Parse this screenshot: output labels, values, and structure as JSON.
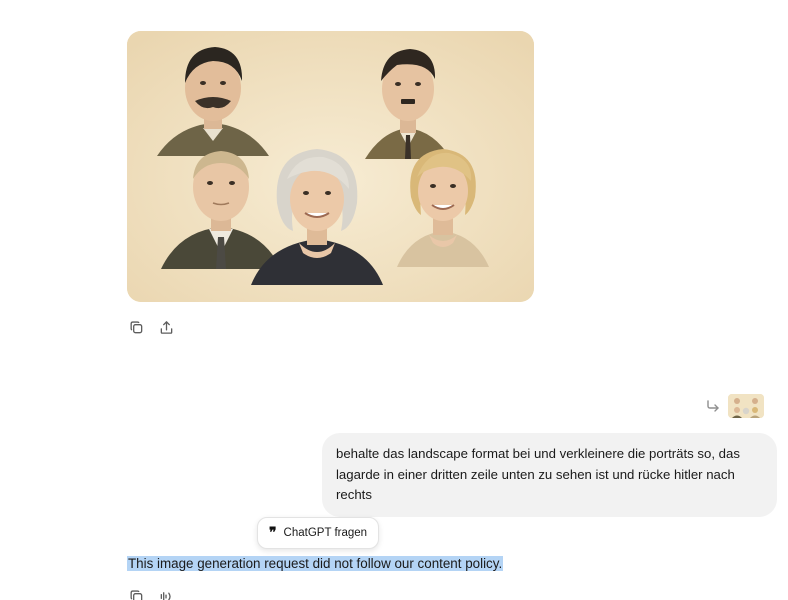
{
  "generated_image": {
    "alt": "",
    "palette": {
      "background": "#f2e3c4",
      "skin": "#e8c7a6",
      "suit_dark": "#3b3a33",
      "suit_olive": "#6e6447",
      "hair_gray": "#d8d4cb",
      "hair_blond": "#d9b878",
      "hair_dark": "#2b2620"
    }
  },
  "image_actions": [
    {
      "icon": "copy-icon"
    },
    {
      "icon": "share-icon"
    }
  ],
  "reply_reference": {
    "icon": "reply-arrow-icon"
  },
  "user_message": {
    "text": "behalte das landscape format bei und verkleinere die porträts so, das lagarde in einer dritten zeile unten zu sehen ist und rücke hitler nach rechts"
  },
  "ask_pill": {
    "icon": "quote-icon",
    "quote_glyph": "❞",
    "label": "ChatGPT fragen"
  },
  "assistant_message": {
    "text": "This image generation request did not follow our content policy."
  },
  "assistant_actions": [
    {
      "icon": "copy-icon"
    },
    {
      "icon": "read-aloud-icon"
    }
  ],
  "colors": {
    "bubble": "#f2f2f2",
    "selection": "#b4d4f5",
    "icon": "#5d5d5d"
  }
}
